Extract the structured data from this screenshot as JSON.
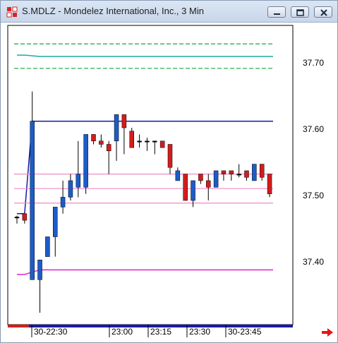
{
  "window": {
    "title": "S.MDLZ - Mondelez International, Inc., 3 Min",
    "icons": [
      "app-icon",
      "minimize-icon",
      "maximize-icon",
      "close-icon"
    ]
  },
  "chart_data": {
    "type": "candlestick",
    "symbol": "S.MDLZ",
    "interval": "3 Min",
    "y_ticks": [
      "37.70",
      "37.60",
      "37.50",
      "37.40"
    ],
    "x_ticks": [
      "30-22:30",
      "23:00",
      "23:15",
      "23:30",
      "30-23:45"
    ],
    "ylim": [
      37.312,
      37.765
    ],
    "candles": [
      {
        "o": 37.475,
        "h": 37.477,
        "l": 37.465,
        "c": 37.475,
        "dir": "flat"
      },
      {
        "o": 37.48,
        "h": 37.48,
        "l": 37.465,
        "c": 37.47,
        "dir": "down"
      },
      {
        "o": 37.38,
        "h": 37.665,
        "l": 37.38,
        "c": 37.62,
        "dir": "up"
      },
      {
        "o": 37.38,
        "h": 37.41,
        "l": 37.33,
        "c": 37.41,
        "dir": "up"
      },
      {
        "o": 37.415,
        "h": 37.445,
        "l": 37.415,
        "c": 37.445,
        "dir": "up"
      },
      {
        "o": 37.445,
        "h": 37.49,
        "l": 37.415,
        "c": 37.49,
        "dir": "up"
      },
      {
        "o": 37.49,
        "h": 37.53,
        "l": 37.48,
        "c": 37.505,
        "dir": "up"
      },
      {
        "o": 37.505,
        "h": 37.54,
        "l": 37.5,
        "c": 37.53,
        "dir": "up"
      },
      {
        "o": 37.52,
        "h": 37.59,
        "l": 37.505,
        "c": 37.54,
        "dir": "up"
      },
      {
        "o": 37.52,
        "h": 37.6,
        "l": 37.51,
        "c": 37.6,
        "dir": "up"
      },
      {
        "o": 37.6,
        "h": 37.6,
        "l": 37.585,
        "c": 37.59,
        "dir": "down"
      },
      {
        "o": 37.59,
        "h": 37.6,
        "l": 37.58,
        "c": 37.585,
        "dir": "down"
      },
      {
        "o": 37.585,
        "h": 37.59,
        "l": 37.54,
        "c": 37.575,
        "dir": "down"
      },
      {
        "o": 37.59,
        "h": 37.63,
        "l": 37.56,
        "c": 37.63,
        "dir": "up"
      },
      {
        "o": 37.63,
        "h": 37.63,
        "l": 37.57,
        "c": 37.61,
        "dir": "down"
      },
      {
        "o": 37.605,
        "h": 37.61,
        "l": 37.58,
        "c": 37.58,
        "dir": "down"
      },
      {
        "o": 37.59,
        "h": 37.6,
        "l": 37.58,
        "c": 37.59,
        "dir": "flat"
      },
      {
        "o": 37.59,
        "h": 37.595,
        "l": 37.575,
        "c": 37.59,
        "dir": "flat"
      },
      {
        "o": 37.59,
        "h": 37.59,
        "l": 37.57,
        "c": 37.59,
        "dir": "flat"
      },
      {
        "o": 37.59,
        "h": 37.59,
        "l": 37.58,
        "c": 37.58,
        "dir": "down"
      },
      {
        "o": 37.585,
        "h": 37.585,
        "l": 37.54,
        "c": 37.55,
        "dir": "down"
      },
      {
        "o": 37.53,
        "h": 37.55,
        "l": 37.53,
        "c": 37.545,
        "dir": "up"
      },
      {
        "o": 37.54,
        "h": 37.54,
        "l": 37.5,
        "c": 37.5,
        "dir": "down"
      },
      {
        "o": 37.5,
        "h": 37.53,
        "l": 37.49,
        "c": 37.53,
        "dir": "up"
      },
      {
        "o": 37.54,
        "h": 37.54,
        "l": 37.525,
        "c": 37.53,
        "dir": "down"
      },
      {
        "o": 37.53,
        "h": 37.54,
        "l": 37.5,
        "c": 37.52,
        "dir": "down"
      },
      {
        "o": 37.52,
        "h": 37.545,
        "l": 37.52,
        "c": 37.545,
        "dir": "up"
      },
      {
        "o": 37.545,
        "h": 37.545,
        "l": 37.53,
        "c": 37.54,
        "dir": "down"
      },
      {
        "o": 37.545,
        "h": 37.545,
        "l": 37.53,
        "c": 37.54,
        "dir": "down"
      },
      {
        "o": 37.54,
        "h": 37.555,
        "l": 37.535,
        "c": 37.54,
        "dir": "flat"
      },
      {
        "o": 37.535,
        "h": 37.545,
        "l": 37.53,
        "c": 37.545,
        "dir": "down"
      },
      {
        "o": 37.53,
        "h": 37.555,
        "l": 37.53,
        "c": 37.555,
        "dir": "up"
      },
      {
        "o": 37.555,
        "h": 37.555,
        "l": 37.53,
        "c": 37.535,
        "dir": "down"
      },
      {
        "o": 37.54,
        "h": 37.54,
        "l": 37.505,
        "c": 37.51,
        "dir": "down"
      }
    ],
    "first_candle_x_index": 0,
    "overlays": [
      {
        "name": "upper-green-outer",
        "color": "#2eae5a",
        "style": "dashed",
        "value": 37.737
      },
      {
        "name": "teal-average",
        "color": "#1aaea0",
        "style": "solid",
        "value": 37.718,
        "start_value": 37.72
      },
      {
        "name": "lower-green",
        "color": "#2eae5a",
        "style": "dashed",
        "value": 37.7
      },
      {
        "name": "blue-high",
        "color": "#1a1aa6",
        "style": "solid",
        "value": 37.62,
        "start_value": 37.48
      },
      {
        "name": "pink-upper",
        "color": "#f08ac8",
        "style": "solid",
        "value": 37.54
      },
      {
        "name": "pink-mid",
        "color": "#f08ac8",
        "style": "solid",
        "value": 37.518
      },
      {
        "name": "pink-lower",
        "color": "#f08ac8",
        "style": "solid",
        "value": 37.496
      },
      {
        "name": "magenta-low",
        "color": "#e020d0",
        "style": "solid",
        "value": 37.395,
        "start_value": 37.388
      }
    ],
    "colors": {
      "up": "#1c5cc8",
      "down": "#d41c1c",
      "grid": "#e6c0d6",
      "background": "#ffffff",
      "frame": "#000000",
      "bottom_bar": "#1a1aa6",
      "arrow": "#e01818"
    }
  }
}
